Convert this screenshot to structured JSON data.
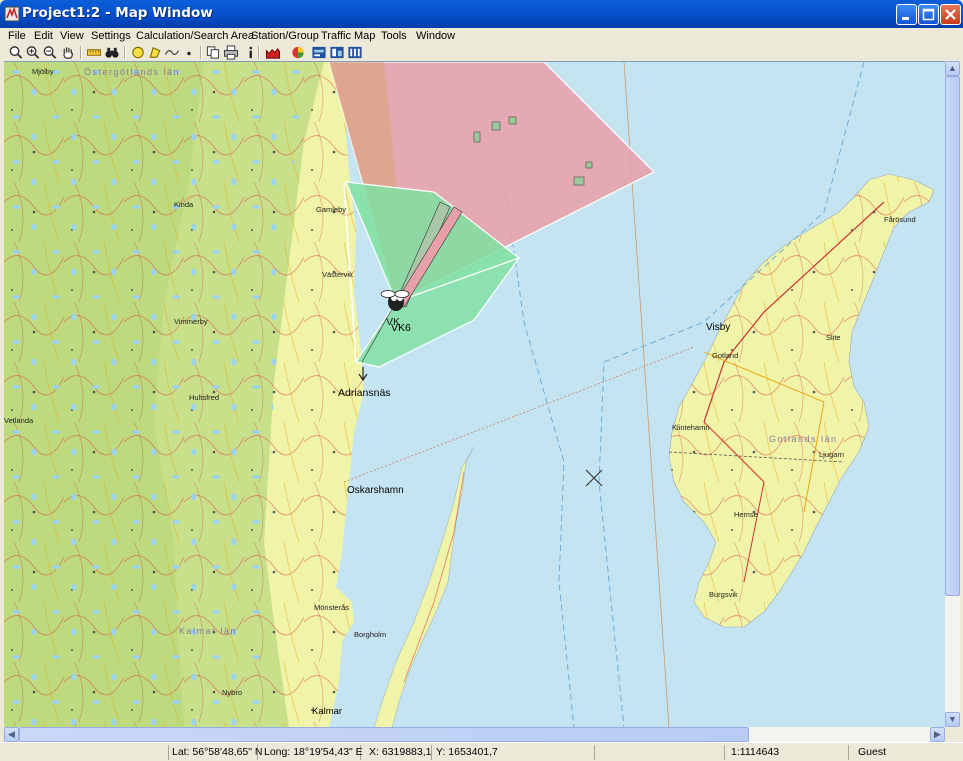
{
  "window": {
    "title": "Project1:2 - Map Window"
  },
  "menu": [
    "File",
    "Edit",
    "View",
    "Settings",
    "Calculation/Search Area",
    "Station/Group",
    "Traffic Map",
    "Tools",
    "Window"
  ],
  "toolbar_icons": [
    "zoom-icon",
    "zoom-in-icon",
    "zoom-out-icon",
    "pan-hand-icon",
    "ruler-icon",
    "binoculars-icon",
    "circle-icon",
    "polygon-icon",
    "line-icon",
    "point-icon",
    "copy-icon",
    "print-icon",
    "info-icon",
    "profile-icon",
    "coverage-icon",
    "map-layer-icon",
    "station-icon",
    "traffic-icon"
  ],
  "map": {
    "labels": {
      "adriansnas": "Adriansnäs",
      "oskarshamn": "Oskarshamn",
      "visby": "Visby",
      "kalmar": "Kalmar",
      "vk6": "VK6",
      "vk_partial": "VK"
    },
    "small_labels": [
      "Mjölby",
      "Kinda",
      "Vetlanda",
      "Vimmerby",
      "Hultsfred",
      "Västervik",
      "Gamleby",
      "Mönsterås",
      "Nybro",
      "Borgholm",
      "Slite",
      "Hemse",
      "Klintehamn",
      "Ljugarn",
      "Burgsvik",
      "Fårösund",
      "Östergötlands län",
      "Gotlands län",
      "Kalmar län",
      "Gotland"
    ]
  },
  "status": {
    "lat": "Lat: 56°58'48,65\" N",
    "long": "Long: 18°19'54,43\" E",
    "x": "X: 6319883,1",
    "y": "Y: 1653401,7",
    "scale": "1:1114643",
    "user": "Guest"
  },
  "colors": {
    "sea": "#C5E4F1",
    "land_green": "#C9E08A",
    "land_yellow": "#F0F4A8",
    "sector_red": "#E8A0A8",
    "sector_green": "#7EE0A0",
    "title_blue": "#0854D0"
  }
}
